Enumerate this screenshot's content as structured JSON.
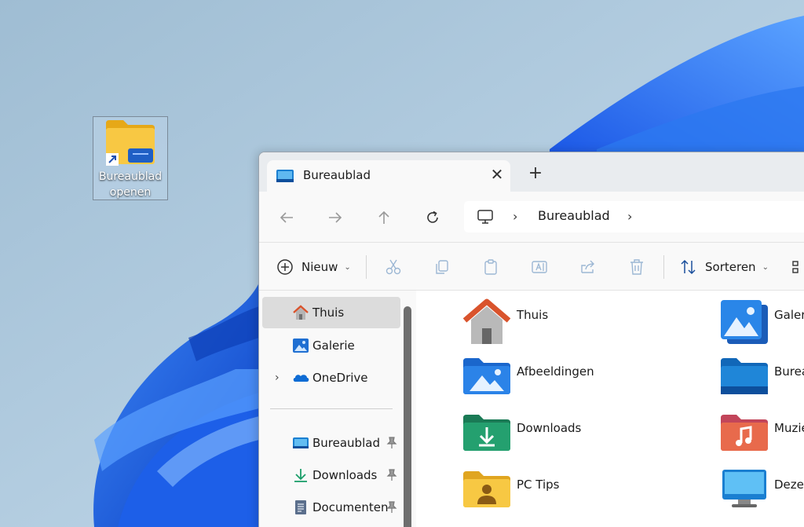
{
  "desktop": {
    "shortcut_label_line1": "Bureaublad",
    "shortcut_label_line2": "openen"
  },
  "window": {
    "tab": {
      "title": "Bureaublad",
      "close_glyph": "✕"
    },
    "new_tab_glyph": "+",
    "address": {
      "crumb": "Bureaublad",
      "separator": "›"
    },
    "toolbar": {
      "new_label": "Nieuw",
      "sort_label": "Sorteren",
      "caret": "⌄"
    },
    "sidebar": {
      "items": [
        {
          "label": "Thuis",
          "icon": "home-icon",
          "selected": true
        },
        {
          "label": "Galerie",
          "icon": "gallery-icon"
        },
        {
          "label": "OneDrive",
          "icon": "onedrive-icon",
          "expandable": true
        },
        {
          "label": "Bureaublad",
          "icon": "desktop-icon",
          "pinned": true
        },
        {
          "label": "Downloads",
          "icon": "download-icon",
          "pinned": true
        },
        {
          "label": "Documenten",
          "icon": "document-icon",
          "pinned": true
        }
      ],
      "expand_glyph": "›"
    },
    "content": {
      "items": [
        {
          "label": "Thuis",
          "icon": "home-large-icon"
        },
        {
          "label": "Afbeeldingen",
          "icon": "pictures-folder-icon"
        },
        {
          "label": "Downloads",
          "icon": "downloads-folder-icon"
        },
        {
          "label": "PC Tips",
          "icon": "user-folder-icon"
        },
        {
          "label": "Galeri",
          "icon": "gallery-large-icon"
        },
        {
          "label": "Burea",
          "icon": "desktop-folder-icon"
        },
        {
          "label": "Muzie",
          "icon": "music-folder-icon"
        },
        {
          "label": "Deze",
          "icon": "this-pc-icon"
        }
      ]
    }
  },
  "colors": {
    "wallpaper_sky": "#a9c6dc",
    "wallpaper_bloom": "#1a5fe0",
    "folder_yellow": "#f7c843",
    "accent_blue": "#1a6fd8"
  }
}
